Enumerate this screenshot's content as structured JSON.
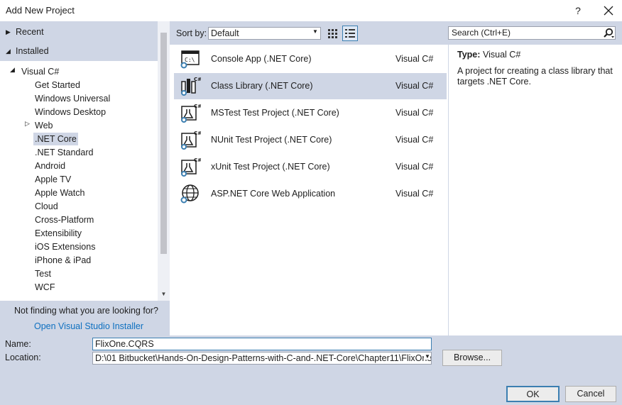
{
  "window": {
    "title": "Add New Project",
    "help_label": "?"
  },
  "left": {
    "recent_label": "Recent",
    "installed_label": "Installed",
    "tree": {
      "root": "Visual C#",
      "items": [
        "Get Started",
        "Windows Universal",
        "Windows Desktop",
        "Web",
        ".NET Core",
        ".NET Standard",
        "Android",
        "Apple TV",
        "Apple Watch",
        "Cloud",
        "Cross-Platform",
        "Extensibility",
        "iOS Extensions",
        "iPhone & iPad",
        "Test",
        "WCF"
      ],
      "selected": ".NET Core"
    },
    "not_finding": "Not finding what you are looking for?",
    "installer_link": "Open Visual Studio Installer"
  },
  "toolbar": {
    "sort_label": "Sort by:",
    "sort_value": "Default"
  },
  "templates": [
    {
      "name": "Console App (.NET Core)",
      "lang": "Visual C#",
      "icon": "console-app-icon"
    },
    {
      "name": "Class Library (.NET Core)",
      "lang": "Visual C#",
      "icon": "class-library-icon"
    },
    {
      "name": "MSTest Test Project (.NET Core)",
      "lang": "Visual C#",
      "icon": "test-project-icon"
    },
    {
      "name": "NUnit Test Project (.NET Core)",
      "lang": "Visual C#",
      "icon": "test-project-icon"
    },
    {
      "name": "xUnit Test Project (.NET Core)",
      "lang": "Visual C#",
      "icon": "test-project-icon"
    },
    {
      "name": "ASP.NET Core Web Application",
      "lang": "Visual C#",
      "icon": "web-application-icon"
    }
  ],
  "selected_template": "Class Library (.NET Core)",
  "search": {
    "placeholder": "Search (Ctrl+E)"
  },
  "details": {
    "type_label": "Type:",
    "type_value": "Visual C#",
    "description": "A project for creating a class library that targets .NET Core."
  },
  "form": {
    "name_label": "Name:",
    "name_value": "FlixOne.CQRS",
    "location_label": "Location:",
    "location_value": "D:\\01 Bitbucket\\Hands-On-Design-Patterns-with-C-and-.NET-Core\\Chapter11\\FlixOne",
    "browse_label": "Browse...",
    "ok_label": "OK",
    "cancel_label": "Cancel"
  },
  "colors": {
    "panel": "#cfd6e5",
    "link": "#0e70c0",
    "accent": "#3c7fb1"
  }
}
